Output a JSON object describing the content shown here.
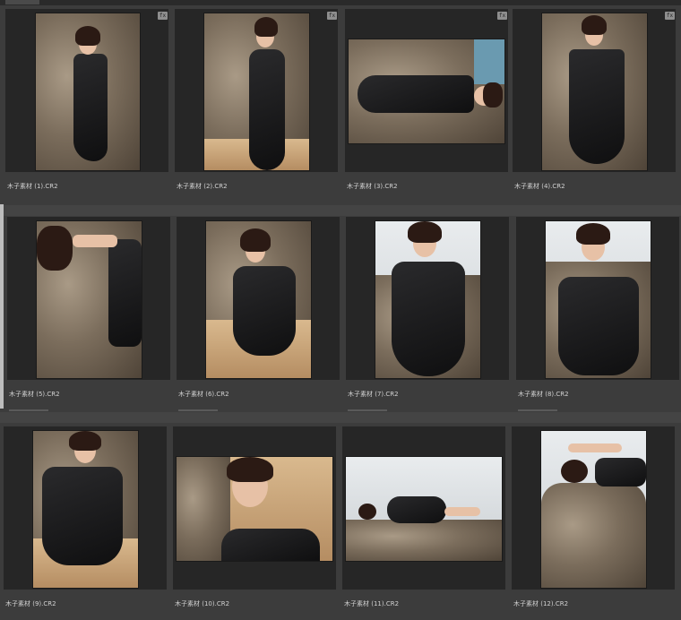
{
  "thumbnails": [
    {
      "filename": "木子素材 (1).CR2",
      "badge": "fx",
      "has_badge": true
    },
    {
      "filename": "木子素材 (2).CR2",
      "badge": "fx",
      "has_badge": true
    },
    {
      "filename": "木子素材 (3).CR2",
      "badge": "fx",
      "has_badge": true
    },
    {
      "filename": "木子素材 (4).CR2",
      "badge": "fx",
      "has_badge": true
    },
    {
      "filename": "木子素材 (5).CR2",
      "has_badge": false
    },
    {
      "filename": "木子素材 (6).CR2",
      "has_badge": false
    },
    {
      "filename": "木子素材 (7).CR2",
      "has_badge": false
    },
    {
      "filename": "木子素材 (8).CR2",
      "has_badge": false
    },
    {
      "filename": "木子素材 (9).CR2",
      "has_badge": false
    },
    {
      "filename": "木子素材 (10).CR2",
      "has_badge": false
    },
    {
      "filename": "木子素材 (11).CR2",
      "has_badge": false
    },
    {
      "filename": "木子素材 (12).CR2",
      "has_badge": false
    }
  ],
  "colors": {
    "background": "#3c3c3c",
    "cell": "#262626",
    "label": "#d2d2d2",
    "badge": "#8e8e8e"
  }
}
